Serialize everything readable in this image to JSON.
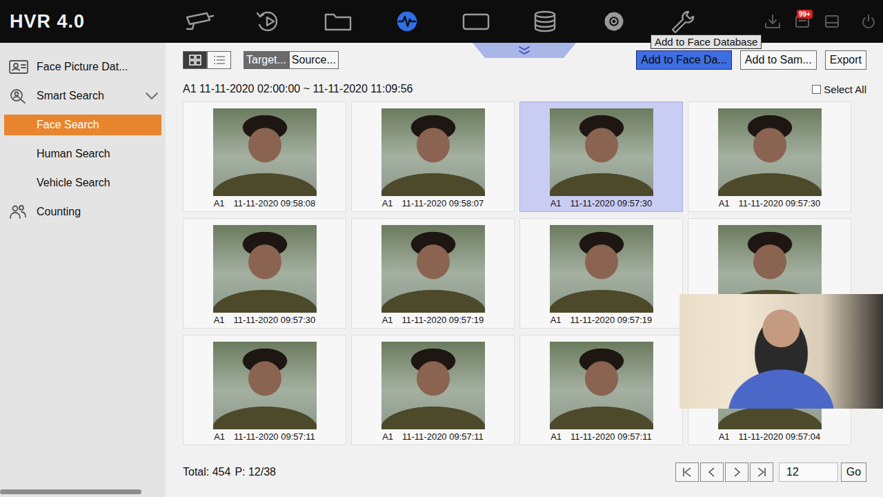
{
  "app": {
    "logo": "HVR 4.0"
  },
  "nav": [
    {
      "kind": "live-view",
      "selected": false
    },
    {
      "kind": "playback",
      "selected": false
    },
    {
      "kind": "file",
      "selected": false
    },
    {
      "kind": "smart",
      "selected": true
    },
    {
      "kind": "display",
      "selected": false
    },
    {
      "kind": "storage",
      "selected": false
    },
    {
      "kind": "configuration",
      "selected": false
    },
    {
      "kind": "maintenance",
      "selected": false
    }
  ],
  "tools": [
    {
      "kind": "download"
    },
    {
      "kind": "alarm",
      "badge": "99+"
    },
    {
      "kind": "device"
    },
    {
      "kind": "power"
    }
  ],
  "tooltip": "Add to Face Database",
  "sidebar": [
    {
      "label": "Face Picture Dat...",
      "kind": "face-database",
      "selected": false
    },
    {
      "label": "Smart Search",
      "kind": "smart-search",
      "expanded": true,
      "selected": false
    },
    {
      "label": "Face Search",
      "kind": "sub",
      "selected": true
    },
    {
      "label": "Human Search",
      "kind": "sub",
      "selected": false
    },
    {
      "label": "Vehicle Search",
      "kind": "sub",
      "selected": false
    },
    {
      "label": "Counting",
      "kind": "counting",
      "selected": false
    }
  ],
  "toolbar": {
    "views": [
      {
        "kind": "grid",
        "selected": true
      },
      {
        "kind": "list",
        "selected": false
      }
    ],
    "filters": [
      {
        "label": "Target...",
        "selected": true
      },
      {
        "label": "Source...",
        "selected": false
      }
    ],
    "actions": [
      {
        "label": "Add to Face Da...",
        "selected": true
      },
      {
        "label": "Add to Sam...",
        "selected": false
      },
      {
        "label": "Export",
        "selected": false
      }
    ]
  },
  "range": "A1 11-11-2020 02:00:00 ~ 11-11-2020 11:09:56",
  "select_all": {
    "label": "Select All",
    "checked": false
  },
  "results": [
    {
      "camera": "A1",
      "time": "11-11-2020 09:58:08",
      "selected": false
    },
    {
      "camera": "A1",
      "time": "11-11-2020 09:58:07",
      "selected": false
    },
    {
      "camera": "A1",
      "time": "11-11-2020 09:57:30",
      "selected": true
    },
    {
      "camera": "A1",
      "time": "11-11-2020 09:57:30",
      "selected": false
    },
    {
      "camera": "A1",
      "time": "11-11-2020 09:57:30",
      "selected": false
    },
    {
      "camera": "A1",
      "time": "11-11-2020 09:57:19",
      "selected": false
    },
    {
      "camera": "A1",
      "time": "11-11-2020 09:57:19",
      "selected": false
    },
    {
      "selected": false
    },
    {
      "camera": "A1",
      "time": "11-11-2020 09:57:11",
      "selected": false
    },
    {
      "camera": "A1",
      "time": "11-11-2020 09:57:11",
      "selected": false
    },
    {
      "camera": "A1",
      "time": "11-11-2020 09:57:11",
      "selected": false
    },
    {
      "camera": "A1",
      "time": "11-11-2020 09:57:04",
      "selected": false
    }
  ],
  "footer": {
    "total": "Total: 454",
    "page": "P: 12/38",
    "pager": [
      {
        "kind": "first"
      },
      {
        "kind": "prev"
      },
      {
        "kind": "next"
      },
      {
        "kind": "last"
      }
    ],
    "page_input": "12",
    "go": "Go"
  }
}
